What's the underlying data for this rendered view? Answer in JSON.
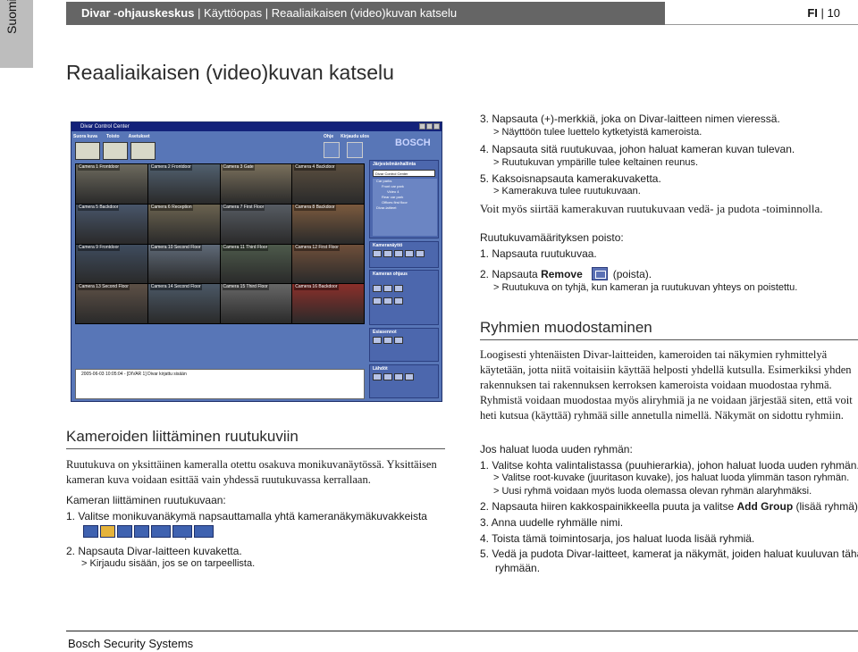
{
  "sidebar_tab": {
    "language": "Suomi"
  },
  "header": {
    "product": "Divar -ohjauskeskus",
    "rest": " | Käyttöopas | Reaaliaikaisen (video)kuvan katselu",
    "lang_code": "FI",
    "page_num": "10"
  },
  "page_title": "Reaaliaikaisen (video)kuvan katselu",
  "screenshot": {
    "window_title": "Divar Control Center",
    "menu_left": [
      "Suora kuva",
      "Toisto",
      "Asetukset"
    ],
    "menu_right": [
      "Ohje",
      "Kirjaudu ulos"
    ],
    "brand": "BOSCH",
    "cameras": [
      "Camera 1 Frontdoor",
      "Camera 2 Frontdoor",
      "Camera 3 Gate",
      "Camera 4 Backdoor",
      "Camera 5 Backdoor",
      "Camera 6 Reception",
      "Camera 7 First Floor",
      "Camera 8 Backdoor",
      "Camera 9 Frontdoor",
      "Camera 10 Second Floor",
      "Camera 11 Third Floor",
      "Camera 12 First Floor",
      "Camera 13 Second Floor",
      "Camera 14 Second Floor",
      "Camera 15 Third Floor",
      "Camera 16 Backdoor"
    ],
    "panel_title": "Järjestelmänhallinta",
    "combo_value": "Divar Control Center",
    "tree_items": [
      "Car parks",
      "Front car park",
      "Video 4",
      "Rear car park",
      "Offices first floor",
      "Divar-laitteet"
    ],
    "panel_view": "Kameranäyttö",
    "panel_ptz": "Kameran ohjaus",
    "panel_preset": "Esiasennot",
    "panel_outputs": "Lähdöt",
    "log_text": "2005-06-03 10:05:04 - [DIVAR 1] Divar kirjattu sisään"
  },
  "right_col": {
    "step3": "3.  Napsauta (+)-merkkiä, joka on Divar-laitteen nimen vieressä.",
    "step3_res": "> Näyttöön tulee luettelo kytketyistä kameroista.",
    "step4": "4.  Napsauta sitä ruutukuvaa, johon haluat kameran kuvan tulevan.",
    "step4_res": "> Ruutukuvan ympärille tulee keltainen reunus.",
    "step5": "5.  Kaksoisnapsauta kamerakuvaketta.",
    "step5_res": "> Kamerakuva tulee ruutukuvaan.",
    "dragdrop": "Voit myös siirtää kamerakuvan ruutukuvaan vedä- ja pudota -toiminnolla.",
    "remove_title": "Ruutukuvamäärityksen poisto:",
    "remove_step1": "1.  Napsauta ruutukuvaa.",
    "remove_step2_pre": "2.  Napsauta",
    "remove_step2_bold": "Remove",
    "remove_step2_post": "(poista).",
    "remove_step2_res": "> Ruutukuva on tyhjä, kun kameran ja ruutukuvan yhteys on poistettu.",
    "groups_heading": "Ryhmien muodostaminen",
    "groups_para": "Loogisesti yhtenäisten Divar-laitteiden, kameroiden tai näkymien ryhmittelyä käytetään, jotta niitä voitaisiin käyttää helposti yhdellä kutsulla. Esimerkiksi yhden rakennuksen tai rakennuksen kerroksen kameroista voidaan muodostaa ryhmä. Ryhmistä voidaan muodostaa myös aliryhmiä ja ne voidaan järjestää siten, että voit heti kutsua (käyttää) ryhmää sille annetulla nimellä. Näkymät on sidottu ryhmiin.",
    "groups_intro": "Jos haluat luoda uuden ryhmän:",
    "g1": "1.  Valitse kohta valintalistassa (puuhierarkia), johon haluat luoda uuden ryhmän.",
    "g1_res1": "> Valitse root-kuvake (juuritason kuvake), jos haluat luoda ylimmän tason ryhmän.",
    "g1_res2": "> Uusi ryhmä voidaan myös luoda olemassa olevan ryhmän alaryhmäksi.",
    "g2_pre": "2.  Napsauta hiiren kakkospainikkeella puuta ja valitse",
    "g2_bold": "Add Group",
    "g2_post": "(lisää ryhmä).",
    "g3": "3.  Anna uudelle ryhmälle nimi.",
    "g4": "4.  Toista tämä toimintosarja, jos haluat luoda lisää ryhmiä.",
    "g5a": "5.  Vedä ja pudota Divar-laitteet, kamerat ja näkymät, joiden haluat kuuluvan tähän",
    "g5b": "ryhmään."
  },
  "left_col": {
    "heading": "Kameroiden liittäminen ruutukuviin",
    "para": "Ruutukuva on yksittäinen kameralla otettu osakuva monikuvanäytössä. Yksittäisen kameran kuva voidaan esittää vain yhdessä ruutukuvassa kerrallaan.",
    "sub": "Kameran liittäminen ruutukuvaan:",
    "s1": "1.  Valitse monikuvanäkymä napsauttamalla yhtä kameranäkymäkuvakkeista",
    "s1_end": ".",
    "s2": "2.  Napsauta Divar-laitteen kuvaketta.",
    "s2_res": "> Kirjaudu sisään, jos se on tarpeellista."
  },
  "footer": {
    "company": "Bosch Security Systems"
  }
}
